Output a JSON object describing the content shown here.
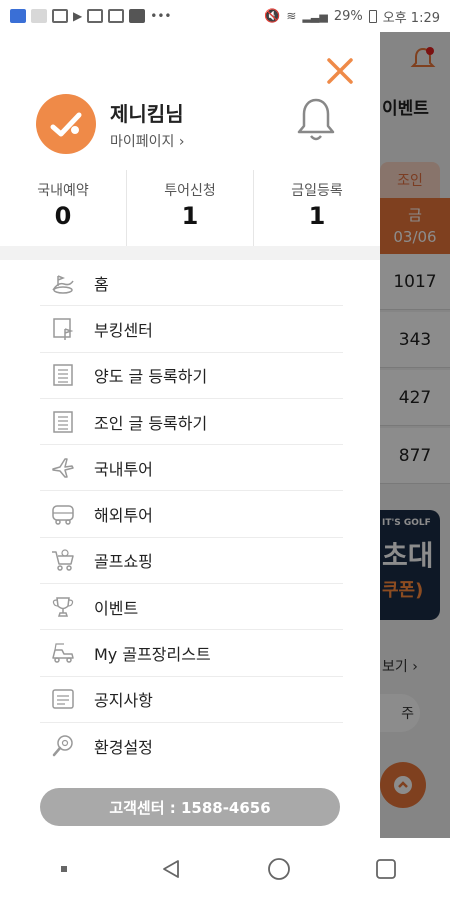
{
  "status_bar": {
    "battery": "29%",
    "time": "오후 1:29"
  },
  "drawer": {
    "close_icon": "close-icon",
    "profile": {
      "name": "제니킴님",
      "mypage_link": "마이페이지 ›"
    },
    "stats": [
      {
        "label": "국내예약",
        "value": "0"
      },
      {
        "label": "투어신청",
        "value": "1"
      },
      {
        "label": "금일등록",
        "value": "1"
      }
    ],
    "menu": [
      {
        "label": "홈",
        "icon": "golf-home-icon"
      },
      {
        "label": "부킹센터",
        "icon": "flag-icon"
      },
      {
        "label": "양도 글 등록하기",
        "icon": "list-icon"
      },
      {
        "label": "조인 글 등록하기",
        "icon": "list-icon"
      },
      {
        "label": "국내투어",
        "icon": "airplane-icon"
      },
      {
        "label": "해외투어",
        "icon": "bus-icon"
      },
      {
        "label": "골프쇼핑",
        "icon": "cart-icon"
      },
      {
        "label": "이벤트",
        "icon": "trophy-icon"
      },
      {
        "label": "My 골프장리스트",
        "icon": "golf-cart-icon"
      },
      {
        "label": "공지사항",
        "icon": "notice-icon"
      },
      {
        "label": "환경설정",
        "icon": "settings-icon"
      }
    ],
    "customer_center": "고객센터 : 1588-4656"
  },
  "background_app": {
    "event_label": "이벤트",
    "join_tab": "조인",
    "date_day": "금",
    "date": "03/06",
    "counts": [
      "1017",
      "343",
      "427",
      "877"
    ],
    "banner_brand": "IT'S GOLF",
    "banner_big": "초대",
    "banner_sub": "쿠폰)",
    "more_link": "보기 ›",
    "chip": "주"
  },
  "colors": {
    "accent": "#e8763a",
    "button_gray": "#a9a9a9"
  }
}
